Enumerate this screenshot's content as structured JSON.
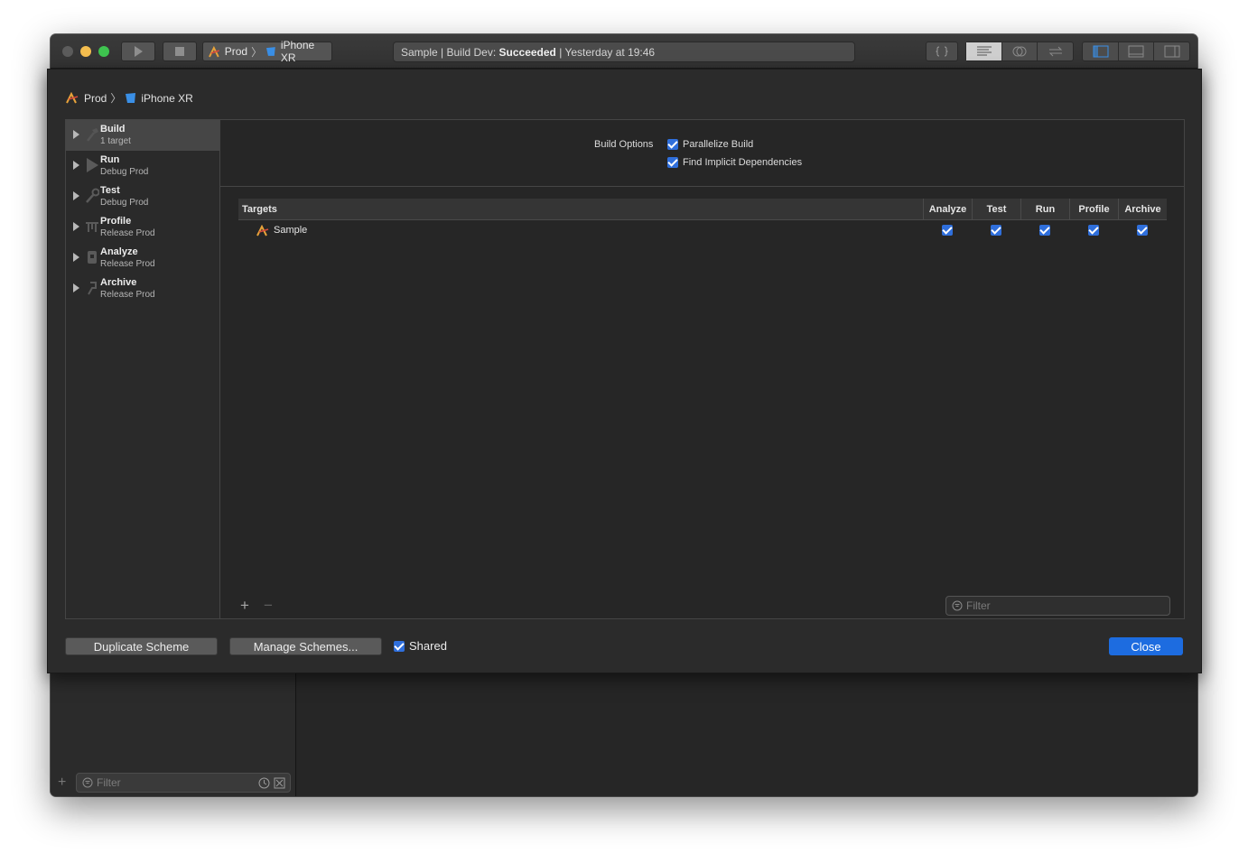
{
  "toolbar": {
    "scheme": "Prod",
    "device": "iPhone XR",
    "activity": {
      "prefix": "Sample | Build Dev: ",
      "status": "Succeeded",
      "suffix": " | Yesterday at 19:46"
    }
  },
  "sheet": {
    "breadcrumb": {
      "scheme": "Prod",
      "device": "iPhone XR"
    },
    "phases": [
      {
        "name": "Build",
        "sub": "1 target",
        "icon": "hammer-icon",
        "selected": true
      },
      {
        "name": "Run",
        "sub": "Debug Prod",
        "icon": "play-icon"
      },
      {
        "name": "Test",
        "sub": "Debug Prod",
        "icon": "wrench-icon"
      },
      {
        "name": "Profile",
        "sub": "Release Prod",
        "icon": "instruments-icon"
      },
      {
        "name": "Analyze",
        "sub": "Release Prod",
        "icon": "analyze-icon"
      },
      {
        "name": "Archive",
        "sub": "Release Prod",
        "icon": "archive-icon"
      }
    ],
    "build_options": {
      "label": "Build Options",
      "parallelize": "Parallelize Build",
      "implicit": "Find Implicit Dependencies"
    },
    "targets": {
      "header": "Targets",
      "columns": [
        "Analyze",
        "Test",
        "Run",
        "Profile",
        "Archive"
      ],
      "rows": [
        {
          "name": "Sample",
          "checks": [
            true,
            true,
            true,
            true,
            true
          ]
        }
      ]
    },
    "filter_placeholder": "Filter",
    "footer": {
      "duplicate": "Duplicate Scheme",
      "manage": "Manage Schemes...",
      "shared": "Shared",
      "close": "Close"
    }
  },
  "navigator": {
    "filter_placeholder": "Filter"
  },
  "colors": {
    "accent": "#1d6ce0",
    "checkbox": "#2f6fdc",
    "window": "#262626"
  }
}
